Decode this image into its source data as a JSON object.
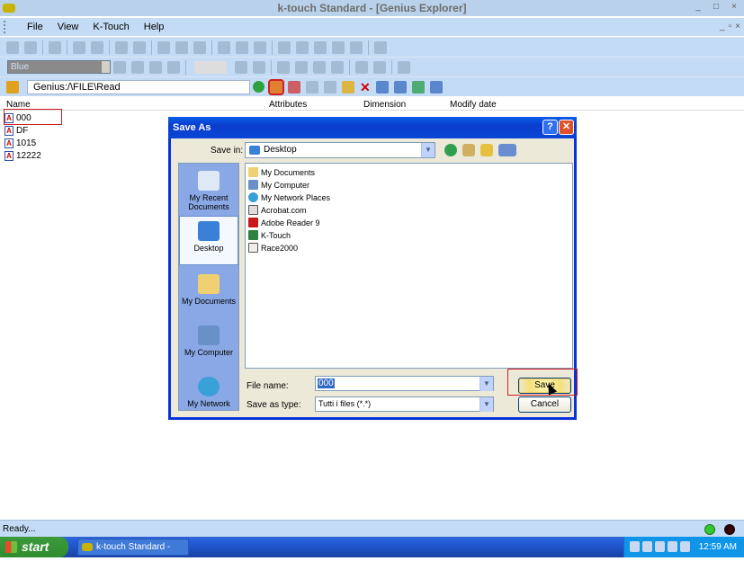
{
  "window": {
    "title": "k-touch Standard - [Genius Explorer]"
  },
  "menu": {
    "items": [
      "File",
      "View",
      "K-Touch",
      "Help"
    ]
  },
  "toolbar": {
    "color_select": "Blue",
    "path": "Genius:/\\FILE\\Read"
  },
  "columns": {
    "name": "Name",
    "attributes": "Attributes",
    "dimension": "Dimension",
    "modify_date": "Modify date"
  },
  "files": [
    "000",
    "DF",
    "1015",
    "12222"
  ],
  "status": {
    "text": "Ready..."
  },
  "taskbar": {
    "start": "start",
    "task": "k-touch Standard - [G...",
    "clock": "12:59 AM"
  },
  "dialog": {
    "title": "Save As",
    "save_in_label": "Save in:",
    "save_in_value": "Desktop",
    "places": [
      "My Recent Documents",
      "Desktop",
      "My Documents",
      "My Computer",
      "My Network"
    ],
    "items": [
      "My Documents",
      "My Computer",
      "My Network Places",
      "Acrobat.com",
      "Adobe Reader 9",
      "K-Touch",
      "Race2000"
    ],
    "file_name_label": "File name:",
    "file_name_value": "000",
    "save_as_type_label": "Save as type:",
    "save_as_type_value": "Tutti i files (*.*)",
    "save_button": "Save",
    "cancel_button": "Cancel"
  }
}
